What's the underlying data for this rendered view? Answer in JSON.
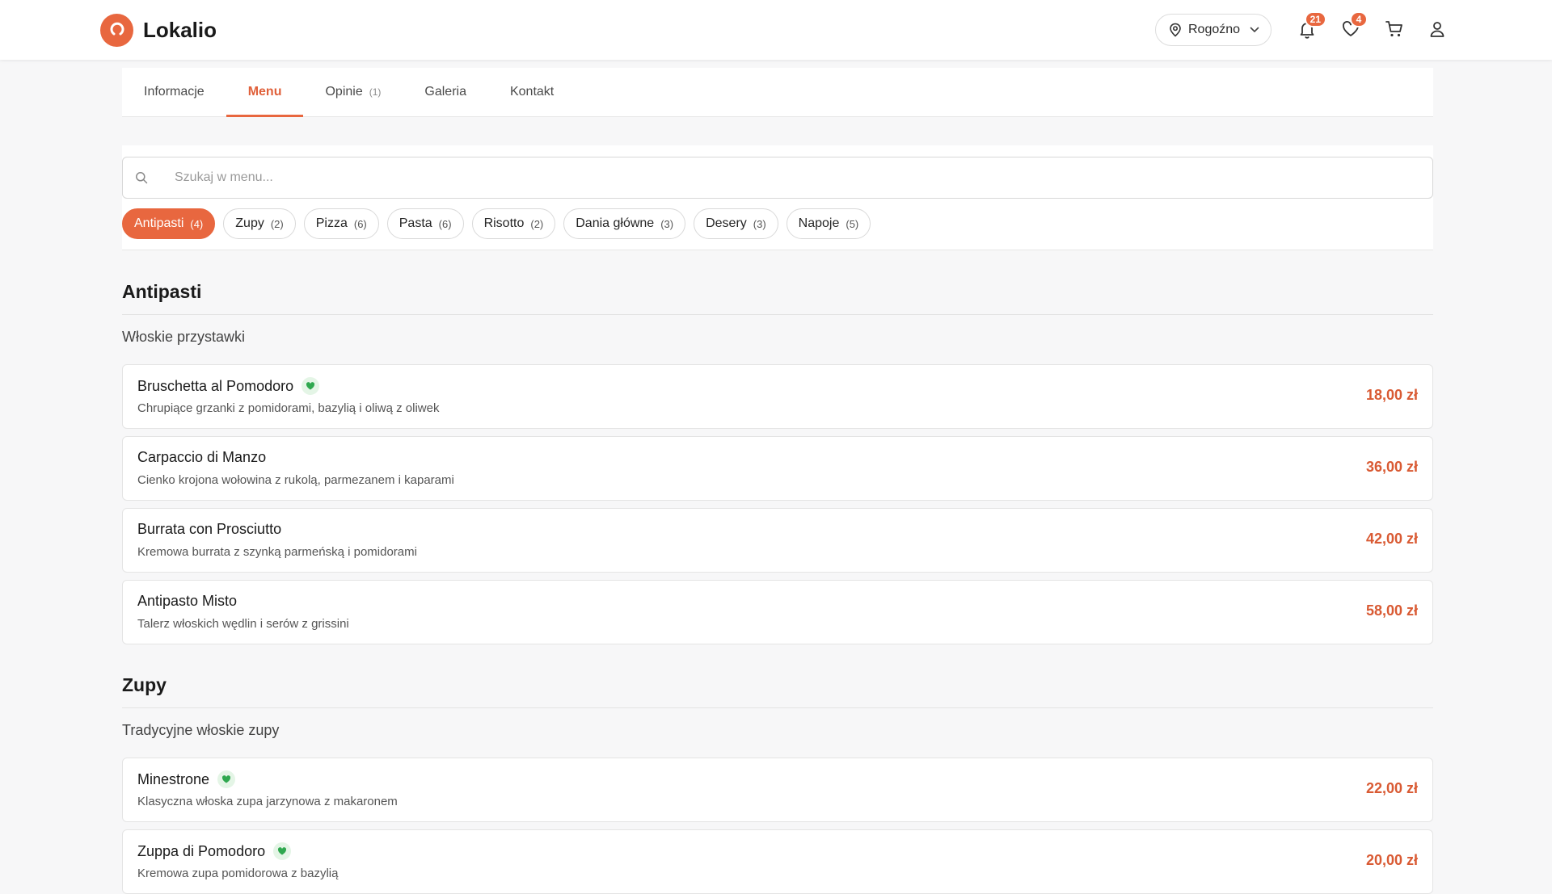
{
  "header": {
    "logo_text": "Lokalio",
    "location": "Rogoźno",
    "notifications_count": "21",
    "favorites_count": "4",
    "accent_color": "#e8673f"
  },
  "tabs": [
    {
      "label": "Informacje",
      "count": ""
    },
    {
      "label": "Menu",
      "count": "",
      "active": true
    },
    {
      "label": "Opinie",
      "count": "(1)"
    },
    {
      "label": "Galeria",
      "count": ""
    },
    {
      "label": "Kontakt",
      "count": ""
    }
  ],
  "search": {
    "placeholder": "Szukaj w menu...",
    "value": ""
  },
  "categories": [
    {
      "label": "Antipasti",
      "count": "(4)",
      "active": true
    },
    {
      "label": "Zupy",
      "count": "(2)"
    },
    {
      "label": "Pizza",
      "count": "(6)"
    },
    {
      "label": "Pasta",
      "count": "(6)"
    },
    {
      "label": "Risotto",
      "count": "(2)"
    },
    {
      "label": "Dania główne",
      "count": "(3)"
    },
    {
      "label": "Desery",
      "count": "(3)"
    },
    {
      "label": "Napoje",
      "count": "(5)"
    }
  ],
  "sections": [
    {
      "title": "Antipasti",
      "subtitle": "Włoskie przystawki",
      "items": [
        {
          "name": "Bruschetta al Pomodoro",
          "desc": "Chrupiące grzanki z pomidorami, bazylią i oliwą z oliwek",
          "price": "18,00 zł",
          "vegetarian": true
        },
        {
          "name": "Carpaccio di Manzo",
          "desc": "Cienko krojona wołowina z rukolą, parmezanem i kaparami",
          "price": "36,00 zł",
          "vegetarian": false
        },
        {
          "name": "Burrata con Prosciutto",
          "desc": "Kremowa burrata z szynką parmeńską i pomidorami",
          "price": "42,00 zł",
          "vegetarian": false
        },
        {
          "name": "Antipasto Misto",
          "desc": "Talerz włoskich wędlin i serów z grissini",
          "price": "58,00 zł",
          "vegetarian": false
        }
      ]
    },
    {
      "title": "Zupy",
      "subtitle": "Tradycyjne włoskie zupy",
      "items": [
        {
          "name": "Minestrone",
          "desc": "Klasyczna włoska zupa jarzynowa z makaronem",
          "price": "22,00 zł",
          "vegetarian": true
        },
        {
          "name": "Zuppa di Pomodoro",
          "desc": "Kremowa zupa pomidorowa z bazylią",
          "price": "20,00 zł",
          "vegetarian": true
        }
      ]
    }
  ]
}
